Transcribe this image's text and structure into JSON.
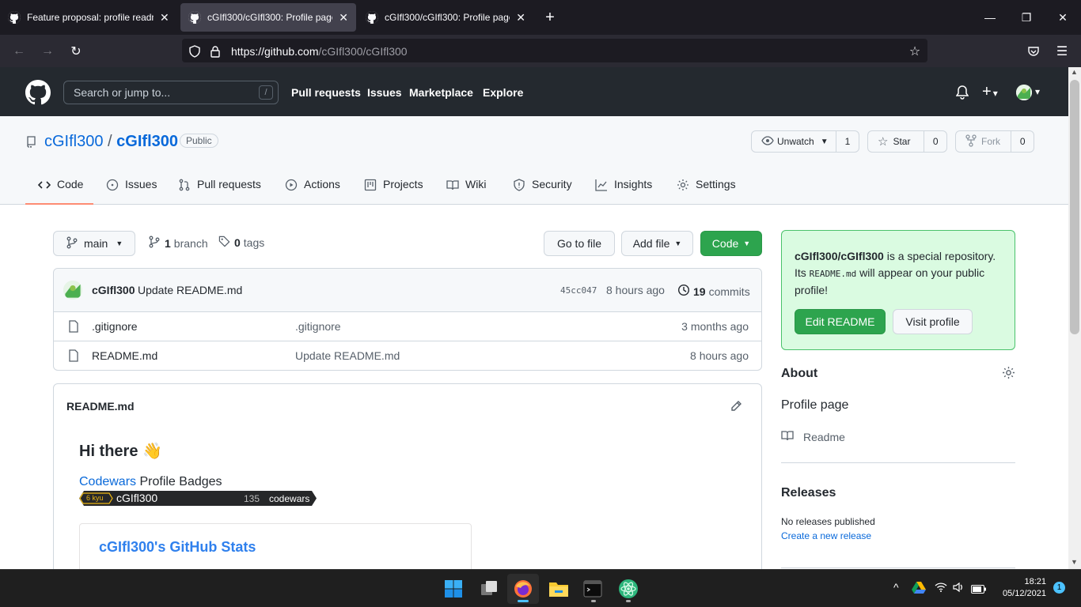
{
  "browser": {
    "tabs": [
      {
        "title": "Feature proposal: profile readme"
      },
      {
        "title": "cGIfl300/cGIfl300: Profile page"
      },
      {
        "title": "cGIfl300/cGIfl300: Profile page"
      }
    ],
    "url_host": "https://github.com",
    "url_path": "/cGIfl300/cGIfl300"
  },
  "github": {
    "search_placeholder": "Search or jump to...",
    "search_slash": "/",
    "nav": [
      "Pull requests",
      "Issues",
      "Marketplace",
      "Explore"
    ],
    "plus": "+",
    "caret": "▾"
  },
  "repo": {
    "owner": "cGIfl300",
    "separator": "/",
    "name": "cGIfl300",
    "visibility": "Public",
    "unwatch_label": "Unwatch",
    "watch_count": "1",
    "star_label": "Star",
    "star_count": "0",
    "fork_label": "Fork",
    "fork_count": "0",
    "tabs": [
      "Code",
      "Issues",
      "Pull requests",
      "Actions",
      "Projects",
      "Wiki",
      "Security",
      "Insights",
      "Settings"
    ]
  },
  "toolbar": {
    "branch": "main",
    "branches_count": "1",
    "branches_label": "branch",
    "tags_count": "0",
    "tags_label": "tags",
    "go_to_file": "Go to file",
    "add_file": "Add file",
    "code": "Code"
  },
  "commit": {
    "author": "cGIfl300",
    "message": "Update README.md",
    "sha": "45cc047",
    "time": "8 hours ago",
    "commits_count": "19",
    "commits_label": "commits"
  },
  "files": [
    {
      "name": ".gitignore",
      "message": ".gitignore",
      "age": "3 months ago"
    },
    {
      "name": "README.md",
      "message": "Update README.md",
      "age": "8 hours ago"
    }
  ],
  "readme": {
    "filename": "README.md",
    "heading": "Hi there",
    "wave": "👋",
    "codewars_link": "Codewars",
    "codewars_suffix": " Profile Badges",
    "badge_kyu": "6 kyu",
    "badge_user": "cGIfl300",
    "badge_score": "135",
    "badge_site": "codewars",
    "stats_title": "cGIfl300's GitHub Stats"
  },
  "sidebar": {
    "special_owner": "cGIfl300/cGIfl300",
    "special_text1": " is a special repository.",
    "special_text2a": "Its ",
    "special_code": "README.md",
    "special_text2b": " will appear on your public",
    "special_text3": "profile!",
    "edit_readme": "Edit README",
    "visit_profile": "Visit profile",
    "about_title": "About",
    "description": "Profile page",
    "readme_link": "Readme",
    "releases_title": "Releases",
    "no_releases": "No releases published",
    "create_release": "Create a new release"
  },
  "taskbar": {
    "time": "18:21",
    "date": "05/12/2021",
    "notifications": "1"
  },
  "colors": {
    "github_header": "#24292f",
    "green_button": "#2da44e",
    "link_blue": "#0969da",
    "active_tab_underline": "#fd8c73"
  }
}
